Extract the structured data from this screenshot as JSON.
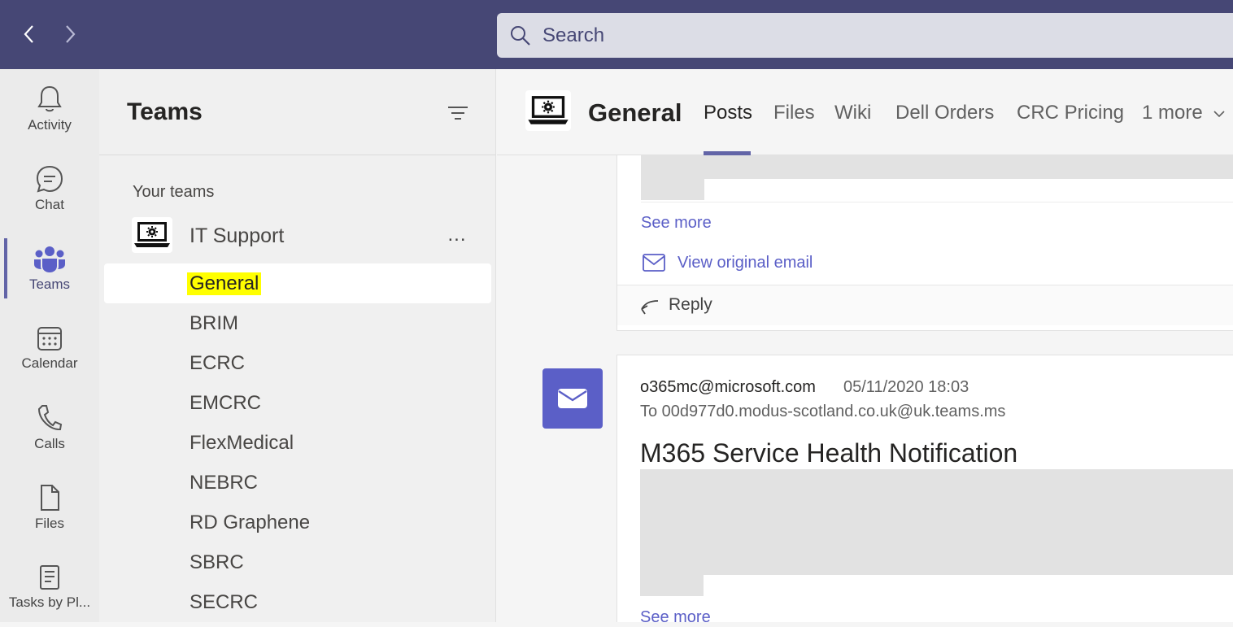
{
  "search": {
    "placeholder": "Search"
  },
  "rail": {
    "items": [
      {
        "label": "Activity"
      },
      {
        "label": "Chat"
      },
      {
        "label": "Teams"
      },
      {
        "label": "Calendar"
      },
      {
        "label": "Calls"
      },
      {
        "label": "Files"
      },
      {
        "label": "Tasks by Pl..."
      }
    ]
  },
  "teams_panel": {
    "title": "Teams",
    "section_label": "Your teams",
    "team": {
      "name": "IT Support",
      "more": "..."
    },
    "channels": [
      {
        "name": "General"
      },
      {
        "name": "BRIM"
      },
      {
        "name": "ECRC"
      },
      {
        "name": "EMCRC"
      },
      {
        "name": "FlexMedical"
      },
      {
        "name": "NEBRC"
      },
      {
        "name": "RD Graphene"
      },
      {
        "name": "SBRC"
      },
      {
        "name": "SECRC"
      }
    ]
  },
  "channel": {
    "title": "General",
    "tabs": [
      {
        "label": "Posts"
      },
      {
        "label": "Files"
      },
      {
        "label": "Wiki"
      },
      {
        "label": "Dell Orders"
      },
      {
        "label": "CRC Pricing"
      },
      {
        "label": "1 more"
      }
    ]
  },
  "post1": {
    "see_more": "See more",
    "view_original": "View original email",
    "reply": "Reply"
  },
  "post2": {
    "sender": "o365mc@microsoft.com",
    "date": "05/11/2020 18:03",
    "to": "To 00d977d0.modus-scotland.co.uk@uk.teams.ms",
    "subject": "M365 Service Health Notification",
    "see_more": "See more"
  },
  "colors": {
    "topbar": "#464775",
    "accent": "#6264a7",
    "highlight": "#ffff00"
  }
}
